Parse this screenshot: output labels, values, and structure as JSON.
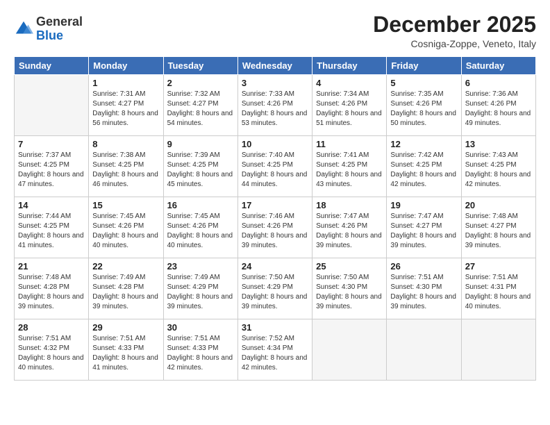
{
  "logo": {
    "general": "General",
    "blue": "Blue"
  },
  "header": {
    "month": "December 2025",
    "location": "Cosniga-Zoppe, Veneto, Italy"
  },
  "weekdays": [
    "Sunday",
    "Monday",
    "Tuesday",
    "Wednesday",
    "Thursday",
    "Friday",
    "Saturday"
  ],
  "weeks": [
    [
      {
        "day": "",
        "empty": true
      },
      {
        "day": "1",
        "sunrise": "Sunrise: 7:31 AM",
        "sunset": "Sunset: 4:27 PM",
        "daylight": "Daylight: 8 hours and 56 minutes."
      },
      {
        "day": "2",
        "sunrise": "Sunrise: 7:32 AM",
        "sunset": "Sunset: 4:27 PM",
        "daylight": "Daylight: 8 hours and 54 minutes."
      },
      {
        "day": "3",
        "sunrise": "Sunrise: 7:33 AM",
        "sunset": "Sunset: 4:26 PM",
        "daylight": "Daylight: 8 hours and 53 minutes."
      },
      {
        "day": "4",
        "sunrise": "Sunrise: 7:34 AM",
        "sunset": "Sunset: 4:26 PM",
        "daylight": "Daylight: 8 hours and 51 minutes."
      },
      {
        "day": "5",
        "sunrise": "Sunrise: 7:35 AM",
        "sunset": "Sunset: 4:26 PM",
        "daylight": "Daylight: 8 hours and 50 minutes."
      },
      {
        "day": "6",
        "sunrise": "Sunrise: 7:36 AM",
        "sunset": "Sunset: 4:26 PM",
        "daylight": "Daylight: 8 hours and 49 minutes."
      }
    ],
    [
      {
        "day": "7",
        "sunrise": "Sunrise: 7:37 AM",
        "sunset": "Sunset: 4:25 PM",
        "daylight": "Daylight: 8 hours and 47 minutes."
      },
      {
        "day": "8",
        "sunrise": "Sunrise: 7:38 AM",
        "sunset": "Sunset: 4:25 PM",
        "daylight": "Daylight: 8 hours and 46 minutes."
      },
      {
        "day": "9",
        "sunrise": "Sunrise: 7:39 AM",
        "sunset": "Sunset: 4:25 PM",
        "daylight": "Daylight: 8 hours and 45 minutes."
      },
      {
        "day": "10",
        "sunrise": "Sunrise: 7:40 AM",
        "sunset": "Sunset: 4:25 PM",
        "daylight": "Daylight: 8 hours and 44 minutes."
      },
      {
        "day": "11",
        "sunrise": "Sunrise: 7:41 AM",
        "sunset": "Sunset: 4:25 PM",
        "daylight": "Daylight: 8 hours and 43 minutes."
      },
      {
        "day": "12",
        "sunrise": "Sunrise: 7:42 AM",
        "sunset": "Sunset: 4:25 PM",
        "daylight": "Daylight: 8 hours and 42 minutes."
      },
      {
        "day": "13",
        "sunrise": "Sunrise: 7:43 AM",
        "sunset": "Sunset: 4:25 PM",
        "daylight": "Daylight: 8 hours and 42 minutes."
      }
    ],
    [
      {
        "day": "14",
        "sunrise": "Sunrise: 7:44 AM",
        "sunset": "Sunset: 4:25 PM",
        "daylight": "Daylight: 8 hours and 41 minutes."
      },
      {
        "day": "15",
        "sunrise": "Sunrise: 7:45 AM",
        "sunset": "Sunset: 4:26 PM",
        "daylight": "Daylight: 8 hours and 40 minutes."
      },
      {
        "day": "16",
        "sunrise": "Sunrise: 7:45 AM",
        "sunset": "Sunset: 4:26 PM",
        "daylight": "Daylight: 8 hours and 40 minutes."
      },
      {
        "day": "17",
        "sunrise": "Sunrise: 7:46 AM",
        "sunset": "Sunset: 4:26 PM",
        "daylight": "Daylight: 8 hours and 39 minutes."
      },
      {
        "day": "18",
        "sunrise": "Sunrise: 7:47 AM",
        "sunset": "Sunset: 4:26 PM",
        "daylight": "Daylight: 8 hours and 39 minutes."
      },
      {
        "day": "19",
        "sunrise": "Sunrise: 7:47 AM",
        "sunset": "Sunset: 4:27 PM",
        "daylight": "Daylight: 8 hours and 39 minutes."
      },
      {
        "day": "20",
        "sunrise": "Sunrise: 7:48 AM",
        "sunset": "Sunset: 4:27 PM",
        "daylight": "Daylight: 8 hours and 39 minutes."
      }
    ],
    [
      {
        "day": "21",
        "sunrise": "Sunrise: 7:48 AM",
        "sunset": "Sunset: 4:28 PM",
        "daylight": "Daylight: 8 hours and 39 minutes."
      },
      {
        "day": "22",
        "sunrise": "Sunrise: 7:49 AM",
        "sunset": "Sunset: 4:28 PM",
        "daylight": "Daylight: 8 hours and 39 minutes."
      },
      {
        "day": "23",
        "sunrise": "Sunrise: 7:49 AM",
        "sunset": "Sunset: 4:29 PM",
        "daylight": "Daylight: 8 hours and 39 minutes."
      },
      {
        "day": "24",
        "sunrise": "Sunrise: 7:50 AM",
        "sunset": "Sunset: 4:29 PM",
        "daylight": "Daylight: 8 hours and 39 minutes."
      },
      {
        "day": "25",
        "sunrise": "Sunrise: 7:50 AM",
        "sunset": "Sunset: 4:30 PM",
        "daylight": "Daylight: 8 hours and 39 minutes."
      },
      {
        "day": "26",
        "sunrise": "Sunrise: 7:51 AM",
        "sunset": "Sunset: 4:30 PM",
        "daylight": "Daylight: 8 hours and 39 minutes."
      },
      {
        "day": "27",
        "sunrise": "Sunrise: 7:51 AM",
        "sunset": "Sunset: 4:31 PM",
        "daylight": "Daylight: 8 hours and 40 minutes."
      }
    ],
    [
      {
        "day": "28",
        "sunrise": "Sunrise: 7:51 AM",
        "sunset": "Sunset: 4:32 PM",
        "daylight": "Daylight: 8 hours and 40 minutes."
      },
      {
        "day": "29",
        "sunrise": "Sunrise: 7:51 AM",
        "sunset": "Sunset: 4:33 PM",
        "daylight": "Daylight: 8 hours and 41 minutes."
      },
      {
        "day": "30",
        "sunrise": "Sunrise: 7:51 AM",
        "sunset": "Sunset: 4:33 PM",
        "daylight": "Daylight: 8 hours and 42 minutes."
      },
      {
        "day": "31",
        "sunrise": "Sunrise: 7:52 AM",
        "sunset": "Sunset: 4:34 PM",
        "daylight": "Daylight: 8 hours and 42 minutes."
      },
      {
        "day": "",
        "empty": true
      },
      {
        "day": "",
        "empty": true
      },
      {
        "day": "",
        "empty": true
      }
    ]
  ]
}
